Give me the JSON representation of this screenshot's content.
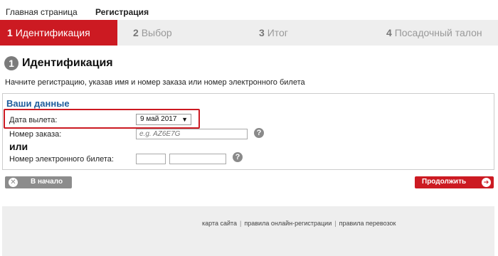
{
  "topnav": {
    "home": "Главная страница",
    "registration": "Регистрация"
  },
  "steps": [
    {
      "num": "1",
      "label": "Идентификация"
    },
    {
      "num": "2",
      "label": "Выбор"
    },
    {
      "num": "3",
      "label": "Итог"
    },
    {
      "num": "4",
      "label": "Посадочный талон"
    }
  ],
  "heading": {
    "number": "1",
    "title": "Идентификация",
    "intro": "Начните регистрацию, указав имя и номер заказа или номер электронного билета"
  },
  "form": {
    "title": "Ваши данные",
    "date_label": "Дата вылета:",
    "date_value": "9 май 2017",
    "order_label": "Номер заказа:",
    "order_placeholder": "e.g. AZ6E7G",
    "or_text": "или",
    "ticket_label": "Номер электронного билета:",
    "help": "?"
  },
  "buttons": {
    "back": "В начало",
    "next": "Продолжить"
  },
  "footer": {
    "links": [
      "карта сайта",
      "правила онлайн-регистрации",
      "правила перевозок"
    ]
  },
  "colors": {
    "accent": "#cc1a22",
    "title_blue": "#1f5d9c"
  }
}
